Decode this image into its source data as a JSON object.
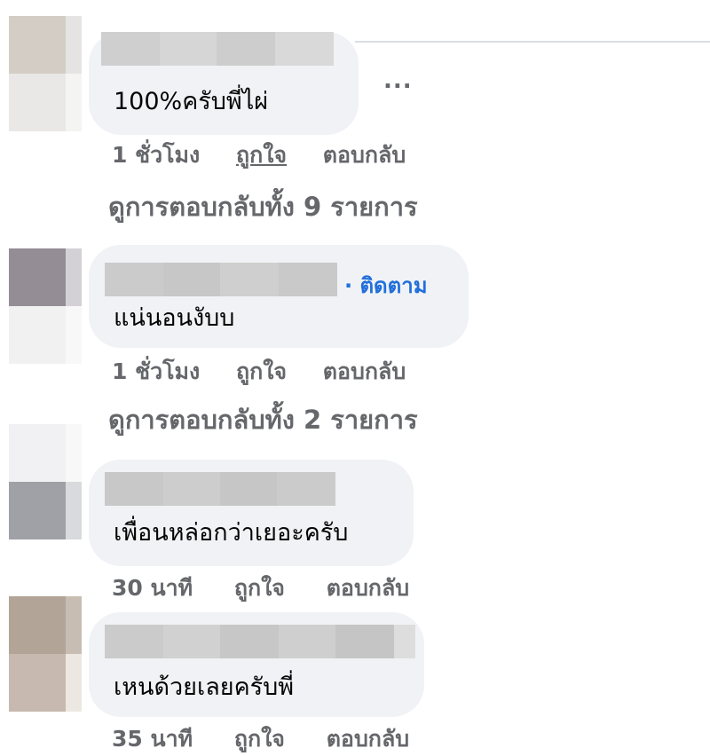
{
  "comments": [
    {
      "text": "100%ครับพี่ไผ่",
      "time": "1 ชั่วโมง",
      "like": "ถูกใจ",
      "reply": "ตอบกลับ",
      "view_replies": "ดูการตอบกลับทั้ง 9 รายการ",
      "more": "..."
    },
    {
      "text": "แน่นอนงับบ",
      "follow": "· ติดตาม",
      "time": "1 ชั่วโมง",
      "like": "ถูกใจ",
      "reply": "ตอบกลับ",
      "view_replies": "ดูการตอบกลับทั้ง 2 รายการ"
    },
    {
      "text": "เพื่อนหล่อกว่าเยอะครับ",
      "time": "30 นาที",
      "like": "ถูกใจ",
      "reply": "ตอบกลับ"
    },
    {
      "text": "เหนด้วยเลยครับพี่",
      "time": "35 นาที",
      "like": "ถูกใจ",
      "reply": "ตอบกลับ"
    }
  ],
  "colors": {
    "bubble": "#f0f2f5",
    "meta_text": "#65676b",
    "link_blue": "#216fdb"
  }
}
